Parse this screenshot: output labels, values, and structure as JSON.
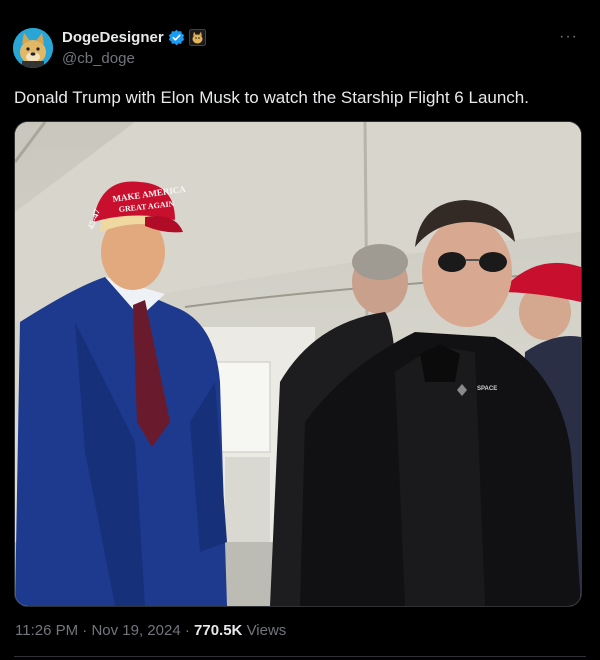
{
  "author": {
    "display_name": "DogeDesigner",
    "handle": "@cb_doge",
    "verified_icon": "verified-badge-icon",
    "affiliate_icon": "doge-affiliate-icon"
  },
  "more_label": "···",
  "post": {
    "text": "Donald Trump with Elon Musk to watch the Starship Flight 6 Launch."
  },
  "meta": {
    "time": "11:26 PM",
    "date": "Nov 19, 2024",
    "separator": "·",
    "views_count": "770.5K",
    "views_label": "Views"
  },
  "colors": {
    "background": "#000000",
    "text": "#e7e9ea",
    "muted": "#71767b",
    "verified": "#1d9bf0",
    "border": "#2f3336"
  }
}
